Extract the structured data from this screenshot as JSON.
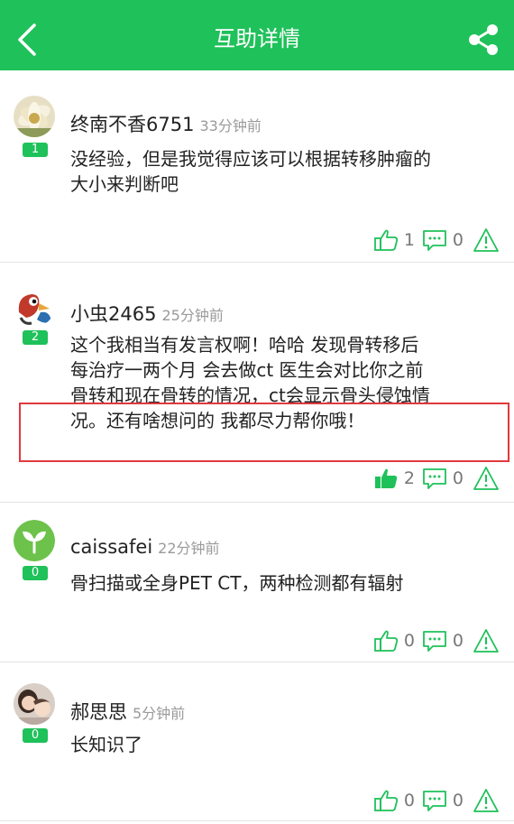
{
  "header": {
    "title": "互助详情",
    "back_icon": "back-icon",
    "share_icon": "share-icon"
  },
  "colors": {
    "brand": "#1fc15a",
    "highlight": "#e0393e",
    "like_active": "#1fc15a"
  },
  "comments": [
    {
      "username": "终南不香6751",
      "time": "33分钟前",
      "level": "1",
      "text": [
        "没经验，但是我觉得应该可以根据转移肿瘤的",
        "大小来判断吧"
      ],
      "likes": "1",
      "replies": "0",
      "liked": false
    },
    {
      "username": "小虫2465",
      "time": "25分钟前",
      "level": "2",
      "text": [
        "这个我相当有发言权啊！哈哈 发现骨转移后",
        "每治疗一两个月 会去做ct 医生会对比你之前",
        "骨转和现在骨转的情况，ct会显示骨头侵蚀情",
        "况。还有啥想问的 我都尽力帮你哦！"
      ],
      "likes": "2",
      "replies": "0",
      "liked": true
    },
    {
      "username": "caissafei",
      "time": "22分钟前",
      "level": "0",
      "text": [
        "骨扫描或全身PET CT，两种检测都有辐射"
      ],
      "likes": "0",
      "replies": "0",
      "liked": false
    },
    {
      "username": "郝思思",
      "time": "5分钟前",
      "level": "0",
      "text": [
        "长知识了"
      ],
      "likes": "0",
      "replies": "0",
      "liked": false
    }
  ]
}
